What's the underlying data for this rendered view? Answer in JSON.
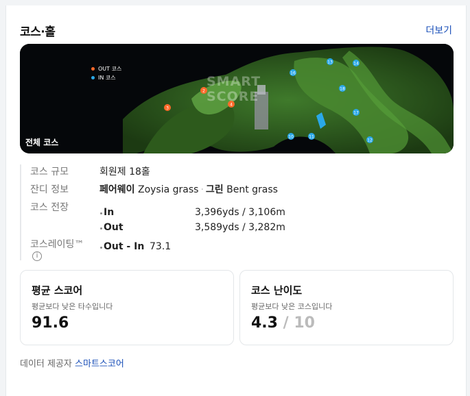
{
  "header": {
    "title": "코스·홀",
    "more_label": "더보기"
  },
  "map": {
    "label": "전체 코스",
    "legend": [
      {
        "label": "OUT 코스",
        "color": "#ff6a2a"
      },
      {
        "label": "IN 코스",
        "color": "#2aa8e8"
      }
    ],
    "watermark_line1": "SMART",
    "watermark_line2": "SCORE",
    "hole_numbers": [
      "2",
      "3",
      "4",
      "10",
      "11",
      "12",
      "13",
      "14",
      "16",
      "17",
      "18"
    ]
  },
  "info": {
    "scale_label": "코스 규모",
    "scale_value": "회원제 18홀",
    "turf_label": "잔디 정보",
    "turf_fairway_name": "페어웨이",
    "turf_fairway_type": "Zoysia grass",
    "turf_green_name": "그린",
    "turf_green_type": "Bent grass",
    "length_label": "코스 전장",
    "length_in_name": "In",
    "length_in_value": "3,396yds / 3,106m",
    "length_out_name": "Out",
    "length_out_value": "3,589yds / 3,282m",
    "rating_label": "코스레이팅™",
    "rating_name": "Out - In",
    "rating_value": "73.1",
    "info_icon_glyph": "i"
  },
  "scores": {
    "avg_title": "평균 스코어",
    "avg_desc": "평균보다 낮은 타수입니다",
    "avg_value": "91.6",
    "difficulty_title": "코스 난이도",
    "difficulty_desc": "평균보다 낮은 코스입니다",
    "difficulty_value": "4.3",
    "difficulty_max": " / 10"
  },
  "footer": {
    "prefix": "데이터 제공자 ",
    "provider": "스마트스코어"
  }
}
